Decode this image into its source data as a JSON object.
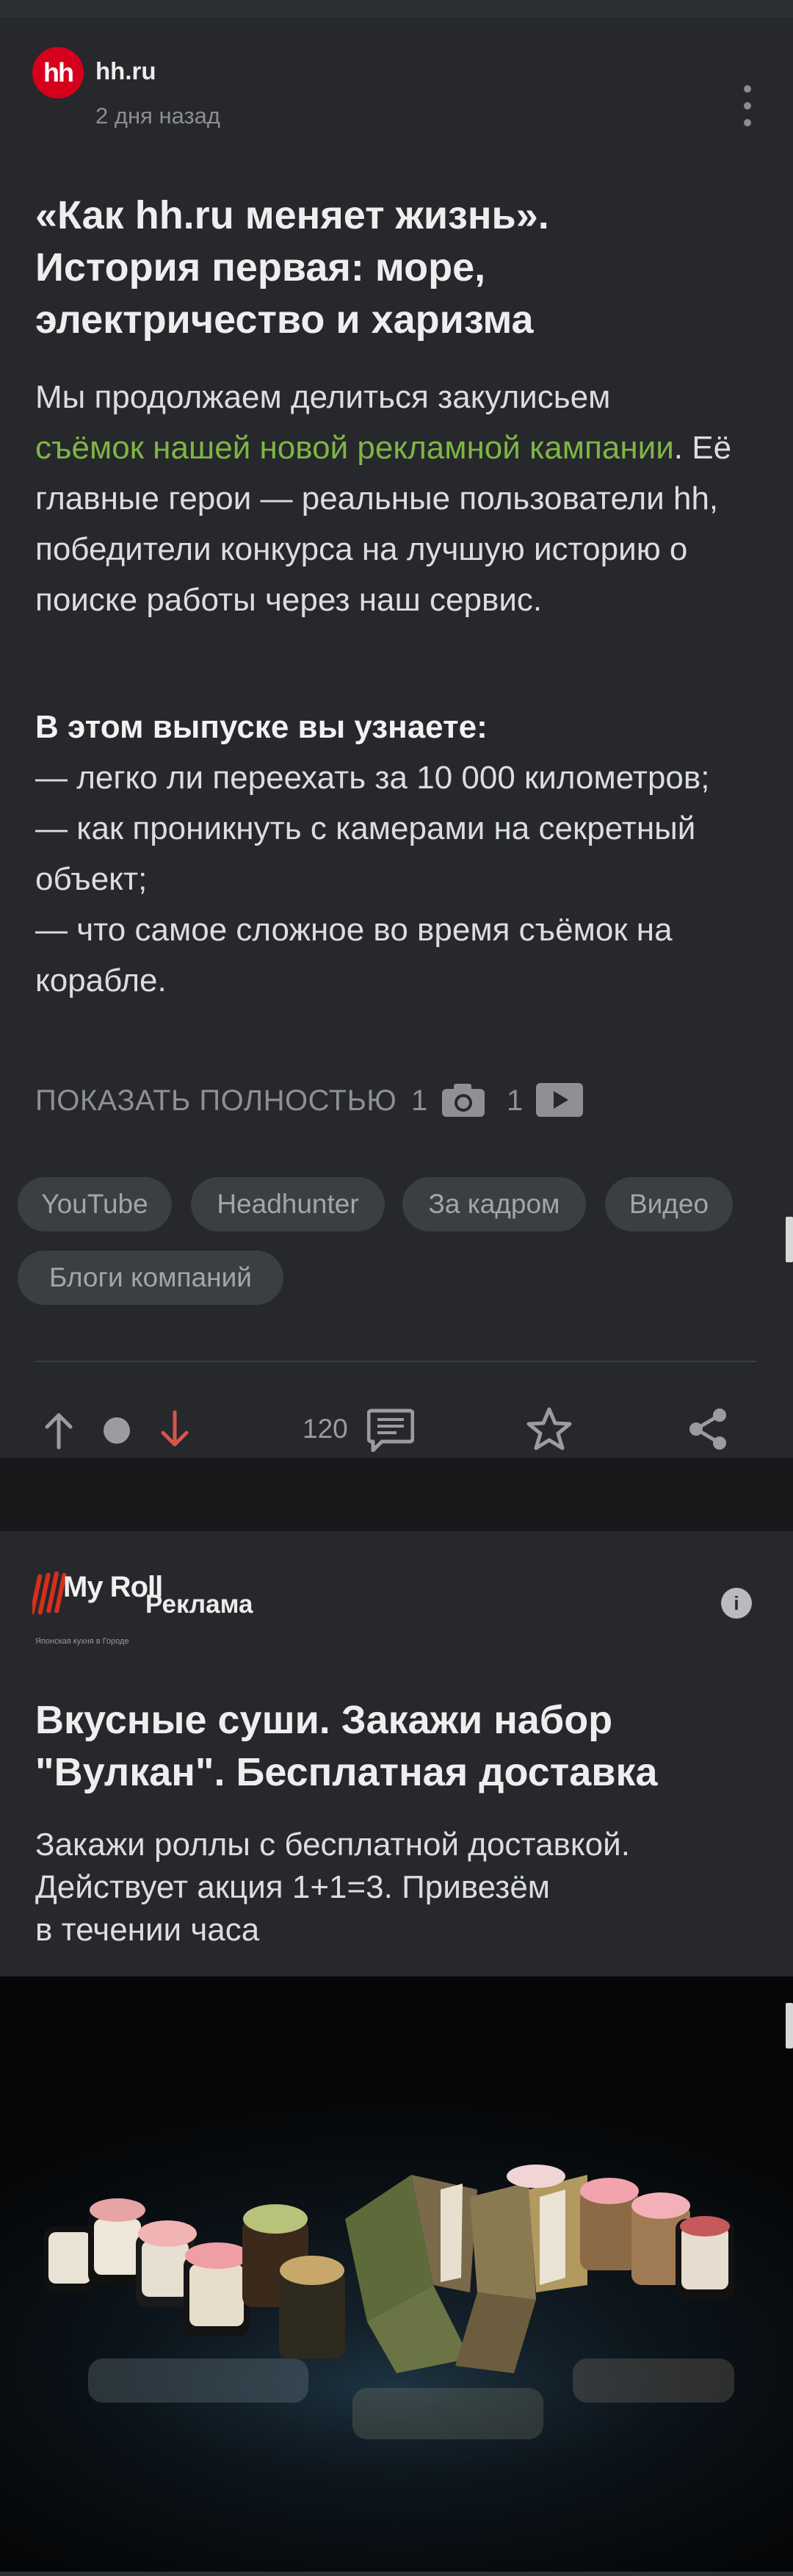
{
  "post": {
    "source_name": "hh.ru",
    "logo_text": "hh",
    "time": "2 дня назад",
    "title_lines": [
      "«Как hh.ru меняет жизнь».",
      "История первая: море,",
      "электричество и харизма"
    ],
    "intro_text_before_link": "Мы продолжаем делиться закулисьем",
    "intro_link_text": "съёмок нашей новой рекламной кампании",
    "intro_text_after_link": ". Её главные герои — реальные пользователи hh, победители конкурса на лучшую историю о поиске работы через наш сервис.",
    "list_heading": "В этом выпуске вы узнаете:",
    "list_items": [
      "— легко ли переехать за 10 000 километров;",
      "— как проникнуть с камерами на секретный объект;",
      "— что самое сложное во время съёмок на корабле."
    ],
    "show_full": "ПОКАЗАТЬ ПОЛНОСТЬЮ",
    "photo_count": "1",
    "video_count": "1",
    "tags": [
      "YouTube",
      "Headhunter",
      "За кадром",
      "Видео",
      "Блоги компаний"
    ],
    "comments_count": "120"
  },
  "ad": {
    "brand_logo_text": "My Roll",
    "brand_tagline": "Японская кухня в Городе",
    "label": "Реклама",
    "info_icon": "i",
    "title_lines": [
      "Вкусные суши. Закажи набор",
      "\"Вулкан\". Бесплатная доставка"
    ],
    "text_lines": [
      "Закажи роллы с бесплатной доставкой.",
      "Действует акция 1+1=3. Привезём",
      "в течении часа"
    ]
  },
  "colors": {
    "card_bg": "#26282c",
    "page_bg": "#18191b",
    "link": "#7fb545",
    "downvote": "#d9534f",
    "hh_red": "#d6001c"
  },
  "icons": [
    "kebab-menu-icon",
    "camera-icon",
    "play-icon",
    "arrow-up-icon",
    "arrow-down-icon",
    "comment-icon",
    "star-icon",
    "share-icon",
    "info-icon"
  ]
}
